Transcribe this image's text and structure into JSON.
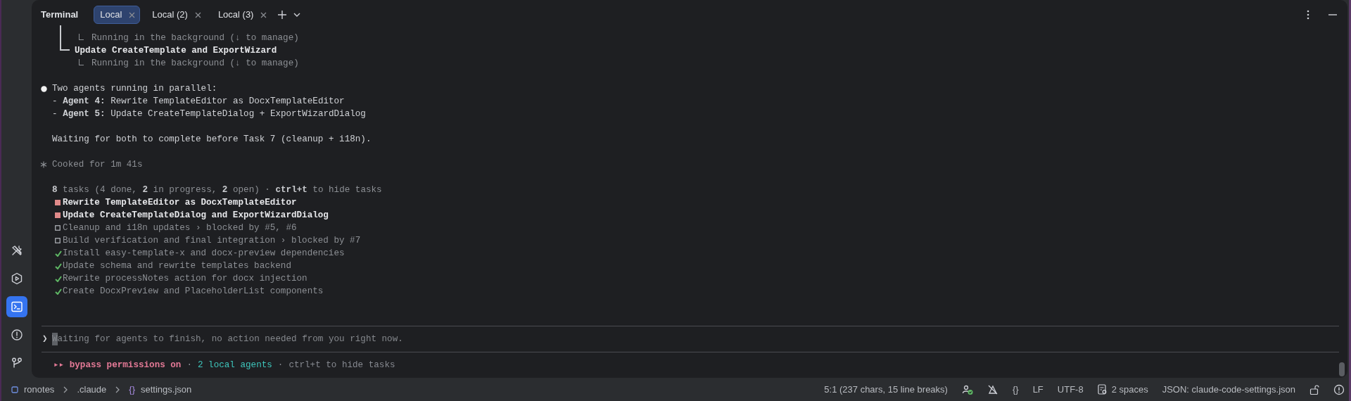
{
  "panel": {
    "title": "Terminal"
  },
  "tabs": [
    {
      "label": "Local",
      "selected": true
    },
    {
      "label": "Local (2)",
      "selected": false
    },
    {
      "label": "Local (3)",
      "selected": false
    }
  ],
  "lines": [
    {
      "kind": "tree-sub",
      "continued": true,
      "text": "Running in the background (↓ to manage)"
    },
    {
      "kind": "tree-item",
      "text": "Update CreateTemplate and ExportWizard"
    },
    {
      "kind": "tree-sub",
      "continued": false,
      "text": "Running in the background (↓ to manage)"
    },
    {
      "kind": "blank"
    },
    {
      "kind": "bullet",
      "text": "Two agents running in parallel:"
    },
    {
      "kind": "text",
      "text": "- **Agent 4:** Rewrite TemplateEditor as DocxTemplateEditor"
    },
    {
      "kind": "text",
      "text": "- **Agent 5:** Update CreateTemplateDialog + ExportWizardDialog"
    },
    {
      "kind": "blank"
    },
    {
      "kind": "text",
      "text": "Waiting for both to complete before Task 7 (cleanup + i18n)."
    },
    {
      "kind": "blank"
    },
    {
      "kind": "note",
      "text": "Cooked for 1m 41s"
    },
    {
      "kind": "blank"
    },
    {
      "kind": "muted",
      "text": "**8** tasks (4 done, **2** in progress, **2** open) · **ctrl+t** to hide tasks"
    },
    {
      "kind": "task-active",
      "text": "Rewrite TemplateEditor as DocxTemplateEditor"
    },
    {
      "kind": "task-active",
      "text": "Update CreateTemplateDialog and ExportWizardDialog"
    },
    {
      "kind": "task-open",
      "text": "Cleanup and i18n updates › blocked by #5, #6"
    },
    {
      "kind": "task-open",
      "text": "Build verification and final integration › blocked by #7"
    },
    {
      "kind": "task-done",
      "text": "Install easy-template-x and docx-preview dependencies"
    },
    {
      "kind": "task-done",
      "text": "Update schema and rewrite templates backend"
    },
    {
      "kind": "task-done",
      "text": "Rewrite processNotes action for docx injection"
    },
    {
      "kind": "task-done",
      "text": "Create DocxPreview and PlaceholderList components"
    }
  ],
  "prompt": {
    "symbol": "❯",
    "placeholder": "Waiting for agents to finish, no action needed from you right now."
  },
  "mode_line": [
    {
      "text": "▸▸ bypass permissions on",
      "color": "#e57a97"
    },
    {
      "text": "·"
    },
    {
      "text": "2 local agents",
      "color": "#3ec5bb"
    },
    {
      "text": "·"
    },
    {
      "text": "ctrl+t to hide tasks",
      "color": "#868990"
    }
  ],
  "toolbar": [
    {
      "kind": "tools",
      "selected": false
    },
    {
      "kind": "run",
      "selected": false
    },
    {
      "kind": "terminal",
      "selected": true
    },
    {
      "kind": "problems",
      "selected": false
    },
    {
      "kind": "git",
      "selected": false
    }
  ],
  "breadcrumb": [
    {
      "kind": "project",
      "text": "ronotes"
    },
    {
      "kind": "folder",
      "text": ".claude"
    },
    {
      "kind": "file",
      "glyph": "{}",
      "text": "settings.json"
    }
  ],
  "status_bar": {
    "position": "5:1 (237 chars, 15 line breaks)",
    "braces": "{}",
    "line_ending": "LF",
    "encoding": "UTF-8",
    "indent": "2 spaces",
    "schema": "JSON: claude-code-settings.json"
  }
}
